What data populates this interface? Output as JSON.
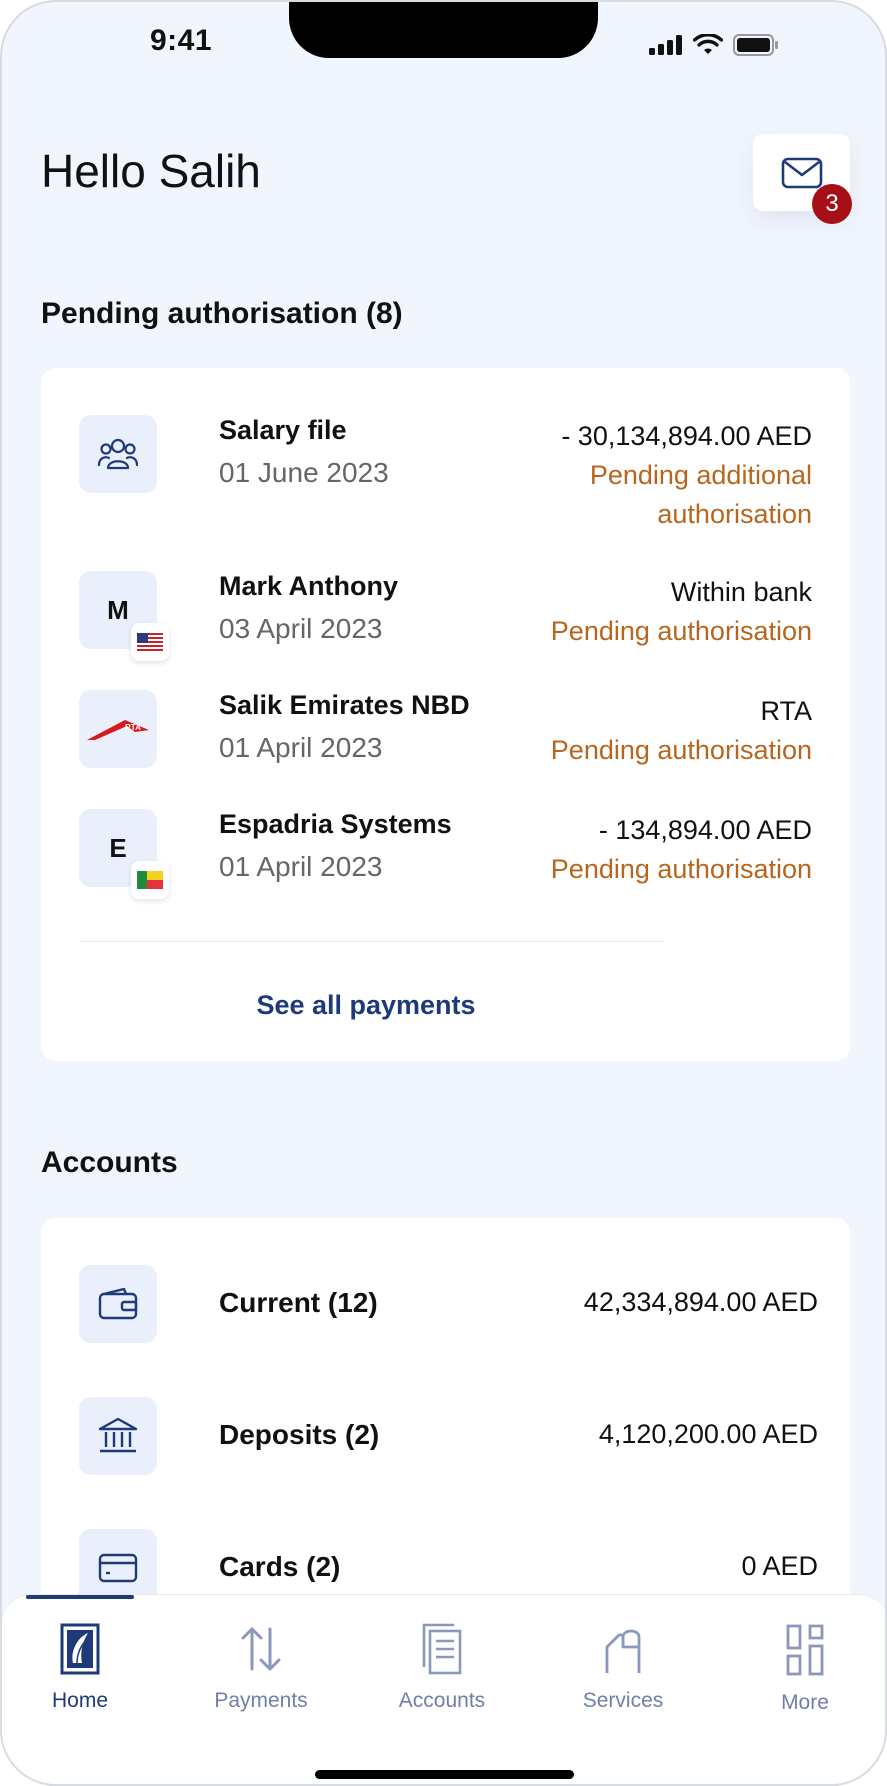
{
  "status_bar": {
    "time": "9:41"
  },
  "header": {
    "greeting": "Hello Salih",
    "messages_badge": "3"
  },
  "pending": {
    "title": "Pending authorisation (8)",
    "items": [
      {
        "name": "Salary file",
        "date": "01 June 2023",
        "amount": "- 30,134,894.00  AED",
        "status_line1": "Pending additional",
        "status_line2": "authorisation",
        "avatar": "group-icon"
      },
      {
        "name": "Mark Anthony",
        "date": "03 April 2023",
        "amount": "Within bank",
        "status_line1": "Pending authorisation",
        "avatar_letter": "M",
        "flag": "us-flag-icon"
      },
      {
        "name": "Salik Emirates NBD",
        "date": "01 April 2023",
        "amount": "RTA",
        "status_line1": "Pending authorisation",
        "avatar": "rta-logo"
      },
      {
        "name": "Espadria Systems",
        "date": "01 April 2023",
        "amount": "- 134,894.00  AED",
        "status_line1": "Pending authorisation",
        "avatar_letter": "E",
        "flag": "benin-flag-icon"
      }
    ],
    "see_all": "See all payments",
    "colors": {
      "status": "#b8661f",
      "link": "#1e3a78"
    }
  },
  "accounts": {
    "title": "Accounts",
    "items": [
      {
        "label": "Current (12)",
        "amount": "42,334,894.00  AED",
        "icon": "wallet-icon"
      },
      {
        "label": "Deposits (2)",
        "amount": "4,120,200.00  AED",
        "icon": "bank-icon"
      },
      {
        "label": "Cards (2)",
        "amount": "0  AED",
        "icon": "card-icon"
      }
    ]
  },
  "tabbar": {
    "tabs": [
      {
        "label": "Home",
        "icon": "home-logo-icon",
        "active": true
      },
      {
        "label": "Payments",
        "icon": "transfer-arrows-icon"
      },
      {
        "label": "Accounts",
        "icon": "documents-icon"
      },
      {
        "label": "Services",
        "icon": "services-icon"
      },
      {
        "label": "More",
        "icon": "grid-icon"
      }
    ]
  }
}
